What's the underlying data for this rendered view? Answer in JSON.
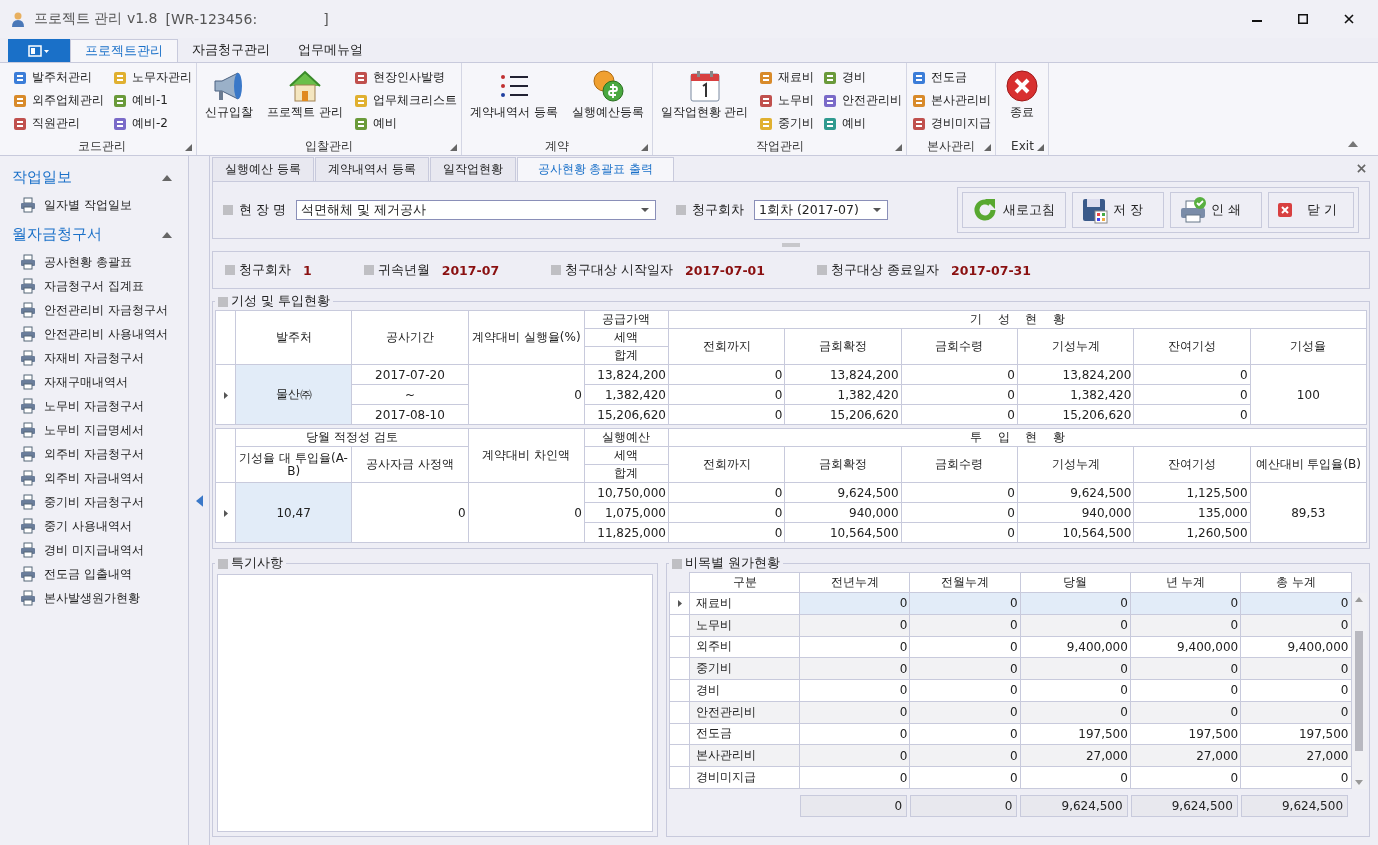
{
  "window": {
    "title": "프로젝트 관리 v1.8",
    "id_prefix": "[WR-123456:",
    "id_suffix": "]"
  },
  "ribbon": {
    "tabs": [
      {
        "label": "프로젝트관리",
        "selected": true
      },
      {
        "label": "자금청구관리",
        "selected": false
      },
      {
        "label": "업무메뉴얼",
        "selected": false
      }
    ],
    "groups": [
      {
        "label": "코드관리",
        "items": [
          {
            "label": "발주처관리",
            "kind": "small"
          },
          {
            "label": "외주업체관리",
            "kind": "small"
          },
          {
            "label": "직원관리",
            "kind": "small"
          },
          {
            "label": "노무자관리",
            "kind": "small"
          },
          {
            "label": "예비-1",
            "kind": "small"
          },
          {
            "label": "예비-2",
            "kind": "small"
          }
        ]
      },
      {
        "label": "입찰관리",
        "items": [
          {
            "label": "신규입찰",
            "kind": "large"
          },
          {
            "label": "프로젝트 관리",
            "kind": "large"
          },
          {
            "label": "현장인사발령",
            "kind": "small"
          },
          {
            "label": "업무체크리스트",
            "kind": "small"
          },
          {
            "label": "예비",
            "kind": "small"
          }
        ]
      },
      {
        "label": "계약",
        "items": [
          {
            "label": "계약내역서 등록",
            "kind": "large"
          },
          {
            "label": "실행예산등록",
            "kind": "large"
          }
        ]
      },
      {
        "label": "작업관리",
        "items": [
          {
            "label": "일작업현황 관리",
            "kind": "large"
          },
          {
            "label": "재료비",
            "kind": "small"
          },
          {
            "label": "노무비",
            "kind": "small"
          },
          {
            "label": "중기비",
            "kind": "small"
          },
          {
            "label": "경비",
            "kind": "small"
          },
          {
            "label": "안전관리비",
            "kind": "small"
          },
          {
            "label": "예비",
            "kind": "small"
          }
        ]
      },
      {
        "label": "본사관리",
        "items": [
          {
            "label": "전도금",
            "kind": "small"
          },
          {
            "label": "본사관리비",
            "kind": "small"
          },
          {
            "label": "경비미지급",
            "kind": "small"
          }
        ]
      },
      {
        "label": "Exit",
        "items": [
          {
            "label": "종료",
            "kind": "large"
          }
        ]
      }
    ]
  },
  "sidebar": {
    "sections": [
      {
        "title": "작업일보",
        "expanded": true,
        "items": [
          "일자별 작업일보"
        ]
      },
      {
        "title": "월자금청구서",
        "expanded": true,
        "items": [
          "공사현황 총괄표",
          "자금청구서 집계표",
          "안전관리비 자금청구서",
          "안전관리비 사용내역서",
          "자재비 자금청구서",
          "자재구매내역서",
          "노무비 자금청구서",
          "노무비 지급명세서",
          "외주비 자금청구서",
          "외주비 자금내역서",
          "중기비 자금청구서",
          "중기 사용내역서",
          "경비 미지급내역서",
          "전도금 입출내역",
          "본사발생원가현황"
        ]
      }
    ]
  },
  "doc_tabs": [
    {
      "label": "실행예산 등록",
      "selected": false
    },
    {
      "label": "계약내역서 등록",
      "selected": false
    },
    {
      "label": "일작업현황",
      "selected": false
    },
    {
      "label": "공사현황 총괄표 출력",
      "selected": true
    }
  ],
  "filter": {
    "site_label": "현 장 명",
    "site_value": "석면해체 및 제거공사",
    "claim_label": "청구회차",
    "claim_value": "1회차 (2017-07)"
  },
  "buttons": [
    {
      "label": "새로고침",
      "kind": "refresh"
    },
    {
      "label": "저 장",
      "kind": "save"
    },
    {
      "label": "인 쇄",
      "kind": "print"
    },
    {
      "label": "닫 기",
      "kind": "close"
    }
  ],
  "info": [
    {
      "label": "청구회차",
      "value": "1"
    },
    {
      "label": "귀속년월",
      "value": "2017-07"
    },
    {
      "label": "청구대상 시작일자",
      "value": "2017-07-01"
    },
    {
      "label": "청구대상 종료일자",
      "value": "2017-07-31"
    }
  ],
  "progress": {
    "title": "기성 및 투입현황",
    "blocks": [
      {
        "left_columns": [
          {
            "label": "발주처"
          },
          {
            "label": "공사기간"
          },
          {
            "label": "계약대비 실행율(%)"
          }
        ],
        "stack_labels": [
          "공급가액",
          "세액",
          "합계"
        ],
        "group_title": "기 성 현 황",
        "columns": [
          "전회까지",
          "금회확정",
          "금회수령",
          "기성누계",
          "잔여기성",
          "기성율"
        ],
        "row": {
          "selected": true,
          "left_cells": [
            "물산㈜",
            [
              "2017-07-20",
              "~",
              "2017-08-10"
            ],
            "0"
          ],
          "lines": [
            [
              "13,824,200",
              "0",
              "13,824,200",
              "0",
              "13,824,200",
              "0"
            ],
            [
              "1,382,420",
              "0",
              "1,382,420",
              "0",
              "1,382,420",
              "0"
            ],
            [
              "15,206,620",
              "0",
              "15,206,620",
              "0",
              "15,206,620",
              "0"
            ]
          ],
          "last": "100"
        }
      },
      {
        "left_columns": [
          {
            "label": "당월 적정성 검토",
            "children": [
              "기성율 대 투입율(A-B)",
              "공사자금 사정액"
            ]
          },
          {
            "label": "계약대비 차인액"
          }
        ],
        "stack_labels": [
          "실행예산",
          "세액",
          "합계"
        ],
        "group_title": "투 입 현 황",
        "columns": [
          "전회까지",
          "금회확정",
          "금회수령",
          "기성누계",
          "잔여기성",
          "예산대비 투입율(B)"
        ],
        "row": {
          "selected": true,
          "left_cells": [
            "10,47",
            "0",
            "0"
          ],
          "lines": [
            [
              "10,750,000",
              "0",
              "9,624,500",
              "0",
              "9,624,500",
              "1,125,500"
            ],
            [
              "1,075,000",
              "0",
              "940,000",
              "0",
              "940,000",
              "135,000"
            ],
            [
              "11,825,000",
              "0",
              "10,564,500",
              "0",
              "10,564,500",
              "1,260,500"
            ]
          ],
          "last": "89,53"
        }
      }
    ]
  },
  "remarks": {
    "title": "특기사항"
  },
  "cost": {
    "title": "비목별 원가현황",
    "columns": [
      "구분",
      "전년누계",
      "전월누계",
      "당월",
      "년 누계",
      "총 누계"
    ],
    "rows": [
      {
        "label": "재료비",
        "values": [
          "0",
          "0",
          "0",
          "0",
          "0"
        ],
        "selected": true
      },
      {
        "label": "노무비",
        "values": [
          "0",
          "0",
          "0",
          "0",
          "0"
        ],
        "selected": false
      },
      {
        "label": "외주비",
        "values": [
          "0",
          "0",
          "9,400,000",
          "9,400,000",
          "9,400,000"
        ],
        "selected": false
      },
      {
        "label": "중기비",
        "values": [
          "0",
          "0",
          "0",
          "0",
          "0"
        ],
        "selected": false
      },
      {
        "label": "경비",
        "values": [
          "0",
          "0",
          "0",
          "0",
          "0"
        ],
        "selected": false
      },
      {
        "label": "안전관리비",
        "values": [
          "0",
          "0",
          "0",
          "0",
          "0"
        ],
        "selected": false
      },
      {
        "label": "전도금",
        "values": [
          "0",
          "0",
          "197,500",
          "197,500",
          "197,500"
        ],
        "selected": false
      },
      {
        "label": "본사관리비",
        "values": [
          "0",
          "0",
          "27,000",
          "27,000",
          "27,000"
        ],
        "selected": false
      },
      {
        "label": "경비미지급",
        "values": [
          "0",
          "0",
          "0",
          "0",
          "0"
        ],
        "selected": false
      }
    ],
    "totals": [
      "0",
      "0",
      "9,624,500",
      "9,624,500",
      "9,624,500"
    ]
  }
}
